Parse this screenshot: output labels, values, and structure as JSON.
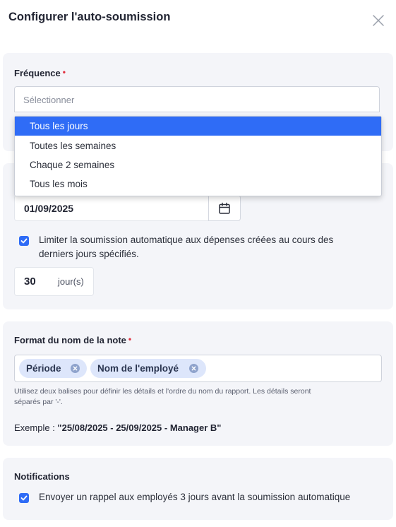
{
  "dialog": {
    "title": "Configurer l'auto-soumission",
    "close_icon": "close-icon"
  },
  "frequency": {
    "label": "Fréquence",
    "required_mark": "•",
    "placeholder": "Sélectionner",
    "options": [
      "Tous les jours",
      "Toutes les semaines",
      "Chaque 2 semaines",
      "Tous les mois"
    ],
    "highlighted_option": "Tous les jours"
  },
  "schedule": {
    "date_value": "01/09/2025",
    "calendar_icon": "calendar-icon",
    "limit_checked": true,
    "limit_text_line1": "Limiter la soumission automatique aux dépenses créées au cours des",
    "limit_text_line2": "derniers jours spécifiés.",
    "days_value": "30",
    "days_unit": "jour(s)"
  },
  "name_format": {
    "label": "Format du nom de la note",
    "required_mark": "•",
    "tags": [
      "Période",
      "Nom de l'employé"
    ],
    "hint_line1": "Utilisez deux balises pour définir les détails et l'ordre du nom du rapport. Les détails seront",
    "hint_line2": "séparés par '-'.",
    "example_prefix": "Exemple : ",
    "example_value": "\"25/08/2025 - 25/09/2025 - Manager B\""
  },
  "notifications": {
    "label": "Notifications",
    "reminder_checked": true,
    "reminder_text": "Envoyer un rappel aux employés 3 jours avant la soumission automatique"
  },
  "colors": {
    "accent": "#2f6cf6",
    "required": "#e0303f",
    "card_bg": "#f4f5f9",
    "tag_bg": "#dde6fb"
  }
}
